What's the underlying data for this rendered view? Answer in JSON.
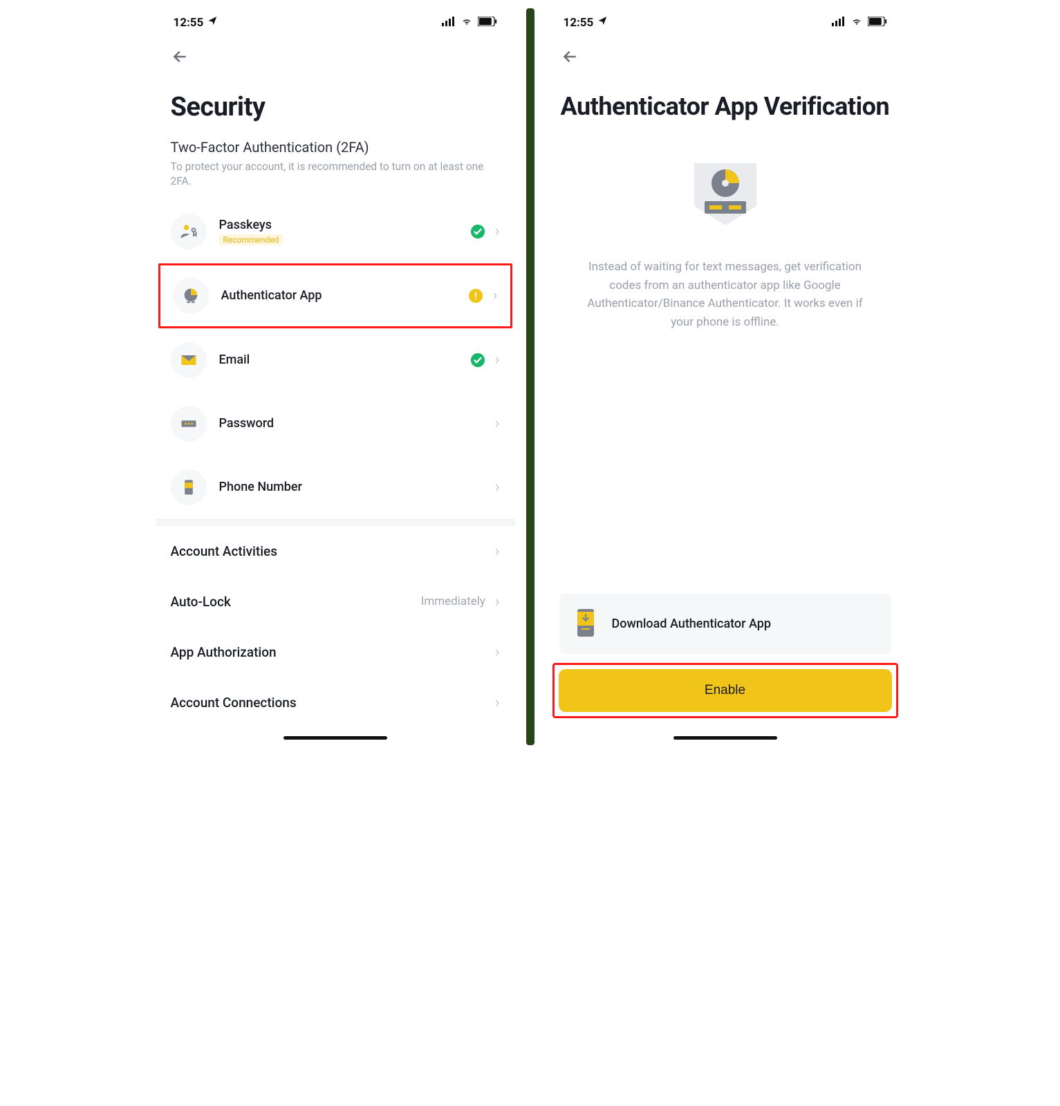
{
  "status_bar": {
    "time": "12:55"
  },
  "left_screen": {
    "title": "Security",
    "section_title": "Two-Factor Authentication (2FA)",
    "section_desc": "To protect your account, it is recommended to turn on at least one 2FA.",
    "items": [
      {
        "label": "Passkeys",
        "badge": "Recommended",
        "status": "ok"
      },
      {
        "label": "Authenticator App",
        "status": "warn"
      },
      {
        "label": "Email",
        "status": "ok"
      },
      {
        "label": "Password",
        "status": ""
      },
      {
        "label": "Phone Number",
        "status": ""
      }
    ],
    "simple_rows": [
      {
        "label": "Account Activities",
        "value": ""
      },
      {
        "label": "Auto-Lock",
        "value": "Immediately"
      },
      {
        "label": "App Authorization",
        "value": ""
      },
      {
        "label": "Account Connections",
        "value": ""
      }
    ]
  },
  "right_screen": {
    "title": "Authenticator App Verification",
    "desc": "Instead of waiting for text messages, get verification codes from an authenticator app like Google Authenticator/Binance Authenticator. It works even if your phone is offline.",
    "download_label": "Download Authenticator App",
    "enable_label": "Enable"
  }
}
